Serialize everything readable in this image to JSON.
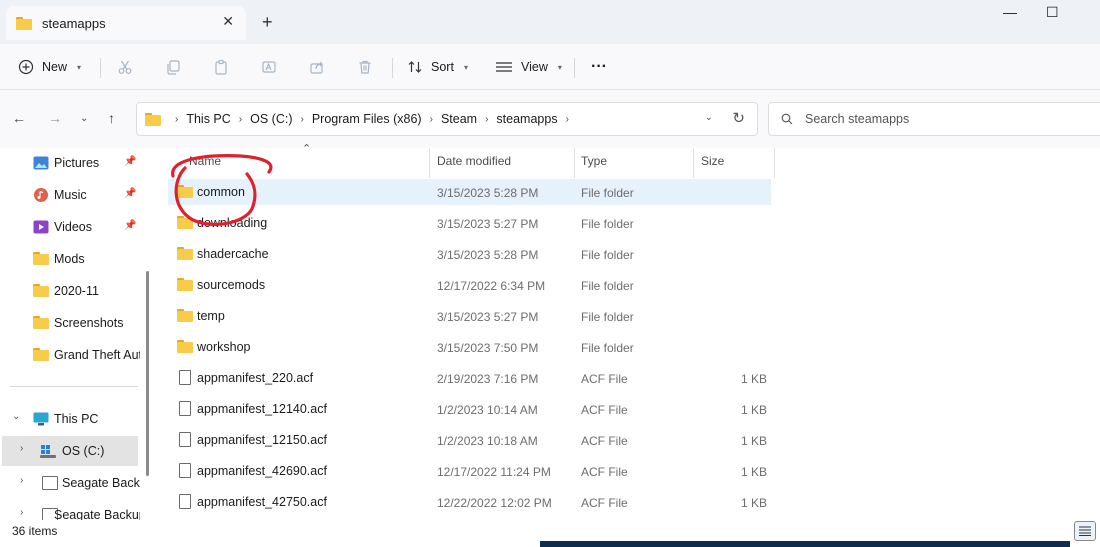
{
  "window": {
    "tab_title": "steamapps",
    "tab_close": "✕",
    "new_tab": "+",
    "minimize": "—",
    "maximize": "☐"
  },
  "toolbar": {
    "new_label": "New",
    "sort_label": "Sort",
    "view_label": "View",
    "more_label": "···"
  },
  "address": {
    "crumbs": [
      "This PC",
      "OS (C:)",
      "Program Files (x86)",
      "Steam",
      "steamapps"
    ],
    "search_placeholder": "Search steamapps"
  },
  "nav": {
    "items": [
      {
        "label": "Pictures",
        "icon": "pictures-icon"
      },
      {
        "label": "Music",
        "icon": "music-icon"
      },
      {
        "label": "Videos",
        "icon": "videos-icon"
      },
      {
        "label": "Mods",
        "icon": "folder-icon"
      },
      {
        "label": "2020-11",
        "icon": "folder-icon"
      },
      {
        "label": "Screenshots",
        "icon": "folder-icon"
      },
      {
        "label": "Grand Theft Aut",
        "icon": "folder-icon"
      },
      {
        "label": "This PC",
        "icon": "this-pc-icon"
      },
      {
        "label": "OS (C:)",
        "icon": "drive-icon"
      },
      {
        "label": "Seagate Backu",
        "icon": "drive-icon"
      },
      {
        "label": "Seagate Backup",
        "icon": "drive-icon"
      }
    ]
  },
  "columns": {
    "name": "Name",
    "date": "Date modified",
    "type": "Type",
    "size": "Size"
  },
  "files": [
    {
      "name": "common",
      "date": "3/15/2023 5:28 PM",
      "type": "File folder",
      "size": "",
      "kind": "folder",
      "selected": true
    },
    {
      "name": "downloading",
      "date": "3/15/2023 5:27 PM",
      "type": "File folder",
      "size": "",
      "kind": "folder"
    },
    {
      "name": "shadercache",
      "date": "3/15/2023 5:28 PM",
      "type": "File folder",
      "size": "",
      "kind": "folder"
    },
    {
      "name": "sourcemods",
      "date": "12/17/2022 6:34 PM",
      "type": "File folder",
      "size": "",
      "kind": "folder"
    },
    {
      "name": "temp",
      "date": "3/15/2023 5:27 PM",
      "type": "File folder",
      "size": "",
      "kind": "folder"
    },
    {
      "name": "workshop",
      "date": "3/15/2023 7:50 PM",
      "type": "File folder",
      "size": "",
      "kind": "folder"
    },
    {
      "name": "appmanifest_220.acf",
      "date": "2/19/2023 7:16 PM",
      "type": "ACF File",
      "size": "1 KB",
      "kind": "file"
    },
    {
      "name": "appmanifest_12140.acf",
      "date": "1/2/2023 10:14 AM",
      "type": "ACF File",
      "size": "1 KB",
      "kind": "file"
    },
    {
      "name": "appmanifest_12150.acf",
      "date": "1/2/2023 10:18 AM",
      "type": "ACF File",
      "size": "1 KB",
      "kind": "file"
    },
    {
      "name": "appmanifest_42690.acf",
      "date": "12/17/2022 11:24 PM",
      "type": "ACF File",
      "size": "1 KB",
      "kind": "file"
    },
    {
      "name": "appmanifest_42750.acf",
      "date": "12/22/2022 12:02 PM",
      "type": "ACF File",
      "size": "1 KB",
      "kind": "file"
    }
  ],
  "status": {
    "item_count": "36 items"
  },
  "colors": {
    "annotation": "#e0202c",
    "selection": "#e5f1fb",
    "folder": "#f8cb4a"
  }
}
